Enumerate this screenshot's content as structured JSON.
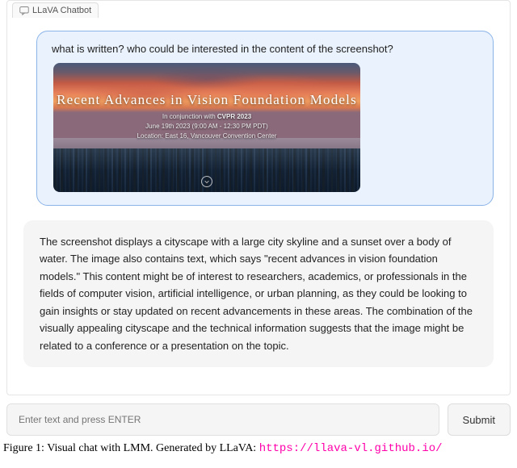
{
  "tab": {
    "label": "LLaVA Chatbot"
  },
  "user": {
    "prompt": "what is written? who could be interested in the content of the screenshot?",
    "banner": {
      "title": "Recent Advances in Vision Foundation Models",
      "line1_prefix": "In conjunction with ",
      "line1_bold": "CVPR 2023",
      "line2": "June 19th 2023 (9:00 AM - 12:30 PM PDT)",
      "line3": "Location: East 16, Vancouver Convention Center"
    }
  },
  "bot": {
    "response": "The screenshot displays a cityscape with a large city skyline and a sunset over a body of water. The image also contains text, which says \"recent advances in vision foundation models.\" This content might be of interest to researchers, academics, or professionals in the fields of computer vision, artificial intelligence, or urban planning, as they could be looking to gain insights or stay updated on recent advancements in these areas. The combination of the visually appealing cityscape and the technical information suggests that the image might be related to a conference or a presentation on the topic."
  },
  "input": {
    "placeholder": "Enter text and press ENTER",
    "submit_label": "Submit"
  },
  "caption": {
    "prefix": "Figure 1: Visual chat with LMM. Generated by LLaVA: ",
    "link": "https://llava-vl.github.io/"
  }
}
